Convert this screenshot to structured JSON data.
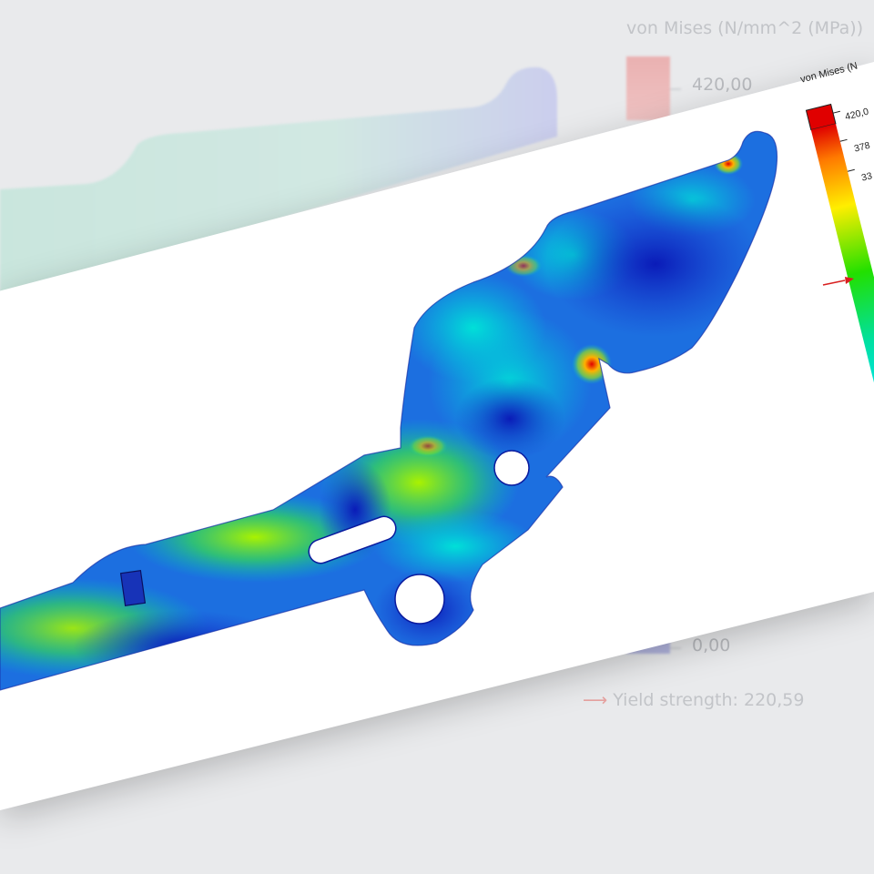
{
  "background": {
    "legend_title": "von Mises (N/mm^2 (MPa))",
    "legend_max": "420,00",
    "legend_min": "0,00",
    "yield_label": "Yield strength: 220,59",
    "colors": {
      "max": "#e7a3a3",
      "min": "#a4a8d8"
    }
  },
  "result_card": {
    "legend_title": "von Mises (N",
    "legend_ticks": [
      "420,0",
      "378",
      "33"
    ],
    "colors": {
      "max": "#e00000",
      "high": "#ffa500",
      "mid": "#ffff00",
      "low": "#00cc33",
      "cyan": "#00e5e5",
      "min": "#0000cc",
      "yield_marker": "#d81f1f"
    }
  },
  "icons": {
    "yield_arrow": "arrow-right-icon"
  }
}
